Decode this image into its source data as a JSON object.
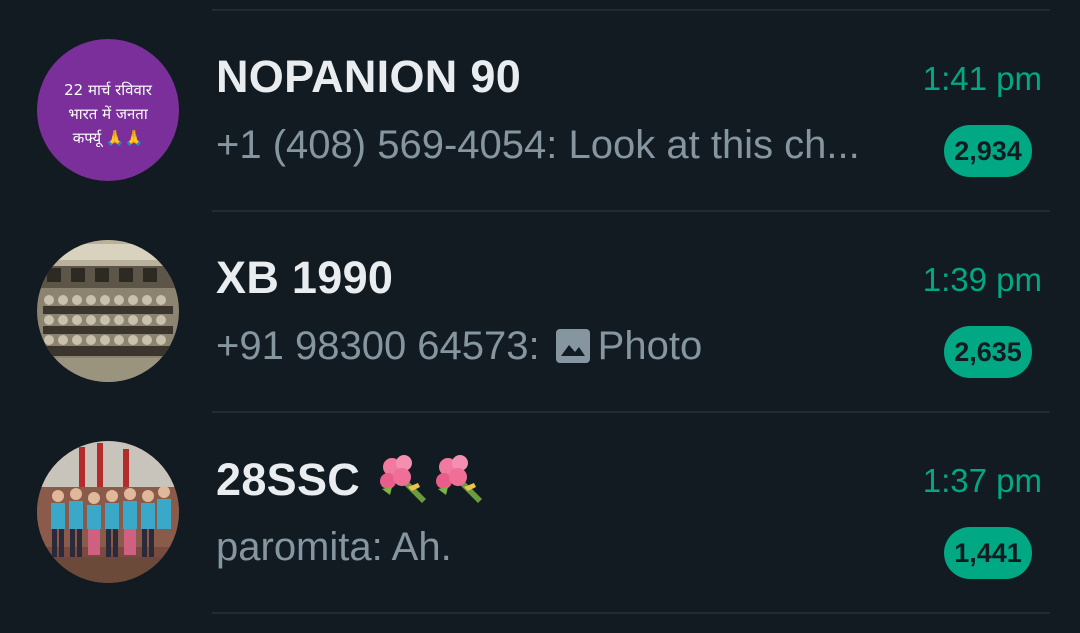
{
  "chats": [
    {
      "name": "NOPANION 90",
      "time": "1:41 pm",
      "sender": "+1 (408) 569-4054:",
      "message": "Look at this ch...",
      "unread": "2,934",
      "avatar_text": [
        "22 मार्च रविवार",
        "भारत में जनता",
        "कर्फ्यू 🙏🙏"
      ],
      "avatar_color": "#7b2f9a"
    },
    {
      "name": "XB 1990",
      "time": "1:39 pm",
      "sender": "+91 98300 64573:",
      "message": "Photo",
      "media_icon": "photo-icon",
      "unread": "2,635"
    },
    {
      "name": "28SSC",
      "name_emoji": [
        "bouquet-icon",
        "bouquet-icon"
      ],
      "time": "1:37 pm",
      "sender": "paromita:",
      "message": "Ah.",
      "unread": "1,441"
    }
  ],
  "colors": {
    "background": "#121b22",
    "accent": "#00a884",
    "title": "#e9edef",
    "subtitle": "#8696a0",
    "divider": "#1f2c34"
  }
}
